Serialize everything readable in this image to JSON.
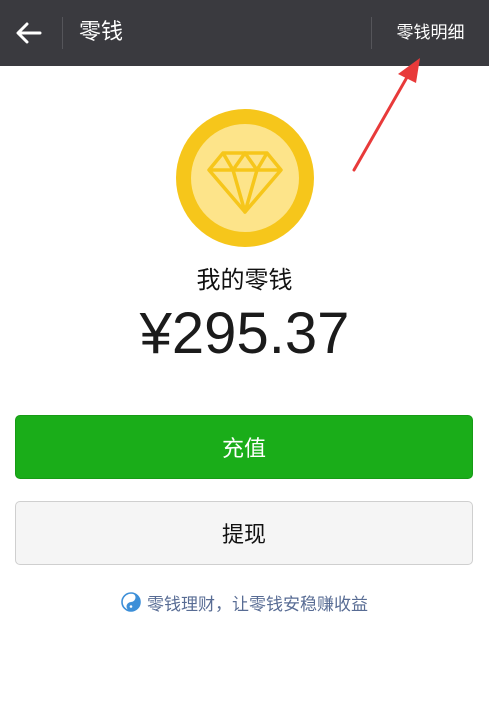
{
  "header": {
    "title": "零钱",
    "detail_link": "零钱明细"
  },
  "wallet": {
    "label": "我的零钱",
    "amount": "¥295.37"
  },
  "actions": {
    "recharge": "充值",
    "withdraw": "提现"
  },
  "promo": {
    "text": "零钱理财，让零钱安稳赚收益"
  },
  "colors": {
    "topbar": "#3a3a3f",
    "primary_green": "#1aad19",
    "coin_gold": "#f6c61b",
    "annotation_red": "#e83a3a",
    "link_blue": "#586c94"
  },
  "icons": [
    "back-arrow-icon",
    "diamond-coin-icon",
    "wealth-icon"
  ]
}
